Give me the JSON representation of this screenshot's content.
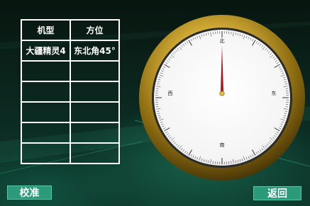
{
  "table": {
    "headers": [
      "机型",
      "方位"
    ],
    "rows": [
      [
        "大疆精灵4",
        "东北角45°"
      ],
      [
        "",
        ""
      ],
      [
        "",
        ""
      ],
      [
        "",
        ""
      ],
      [
        "",
        ""
      ],
      [
        "",
        ""
      ]
    ]
  },
  "compass": {
    "north": "北",
    "east": "东",
    "south": "南",
    "west": "西",
    "needle_heading_deg": 0,
    "needle_color": "#b0101a",
    "bezel_color": "#c9a227"
  },
  "buttons": {
    "calibrate": "校准",
    "back": "返回"
  },
  "colors": {
    "accent": "#2a9a7a"
  }
}
